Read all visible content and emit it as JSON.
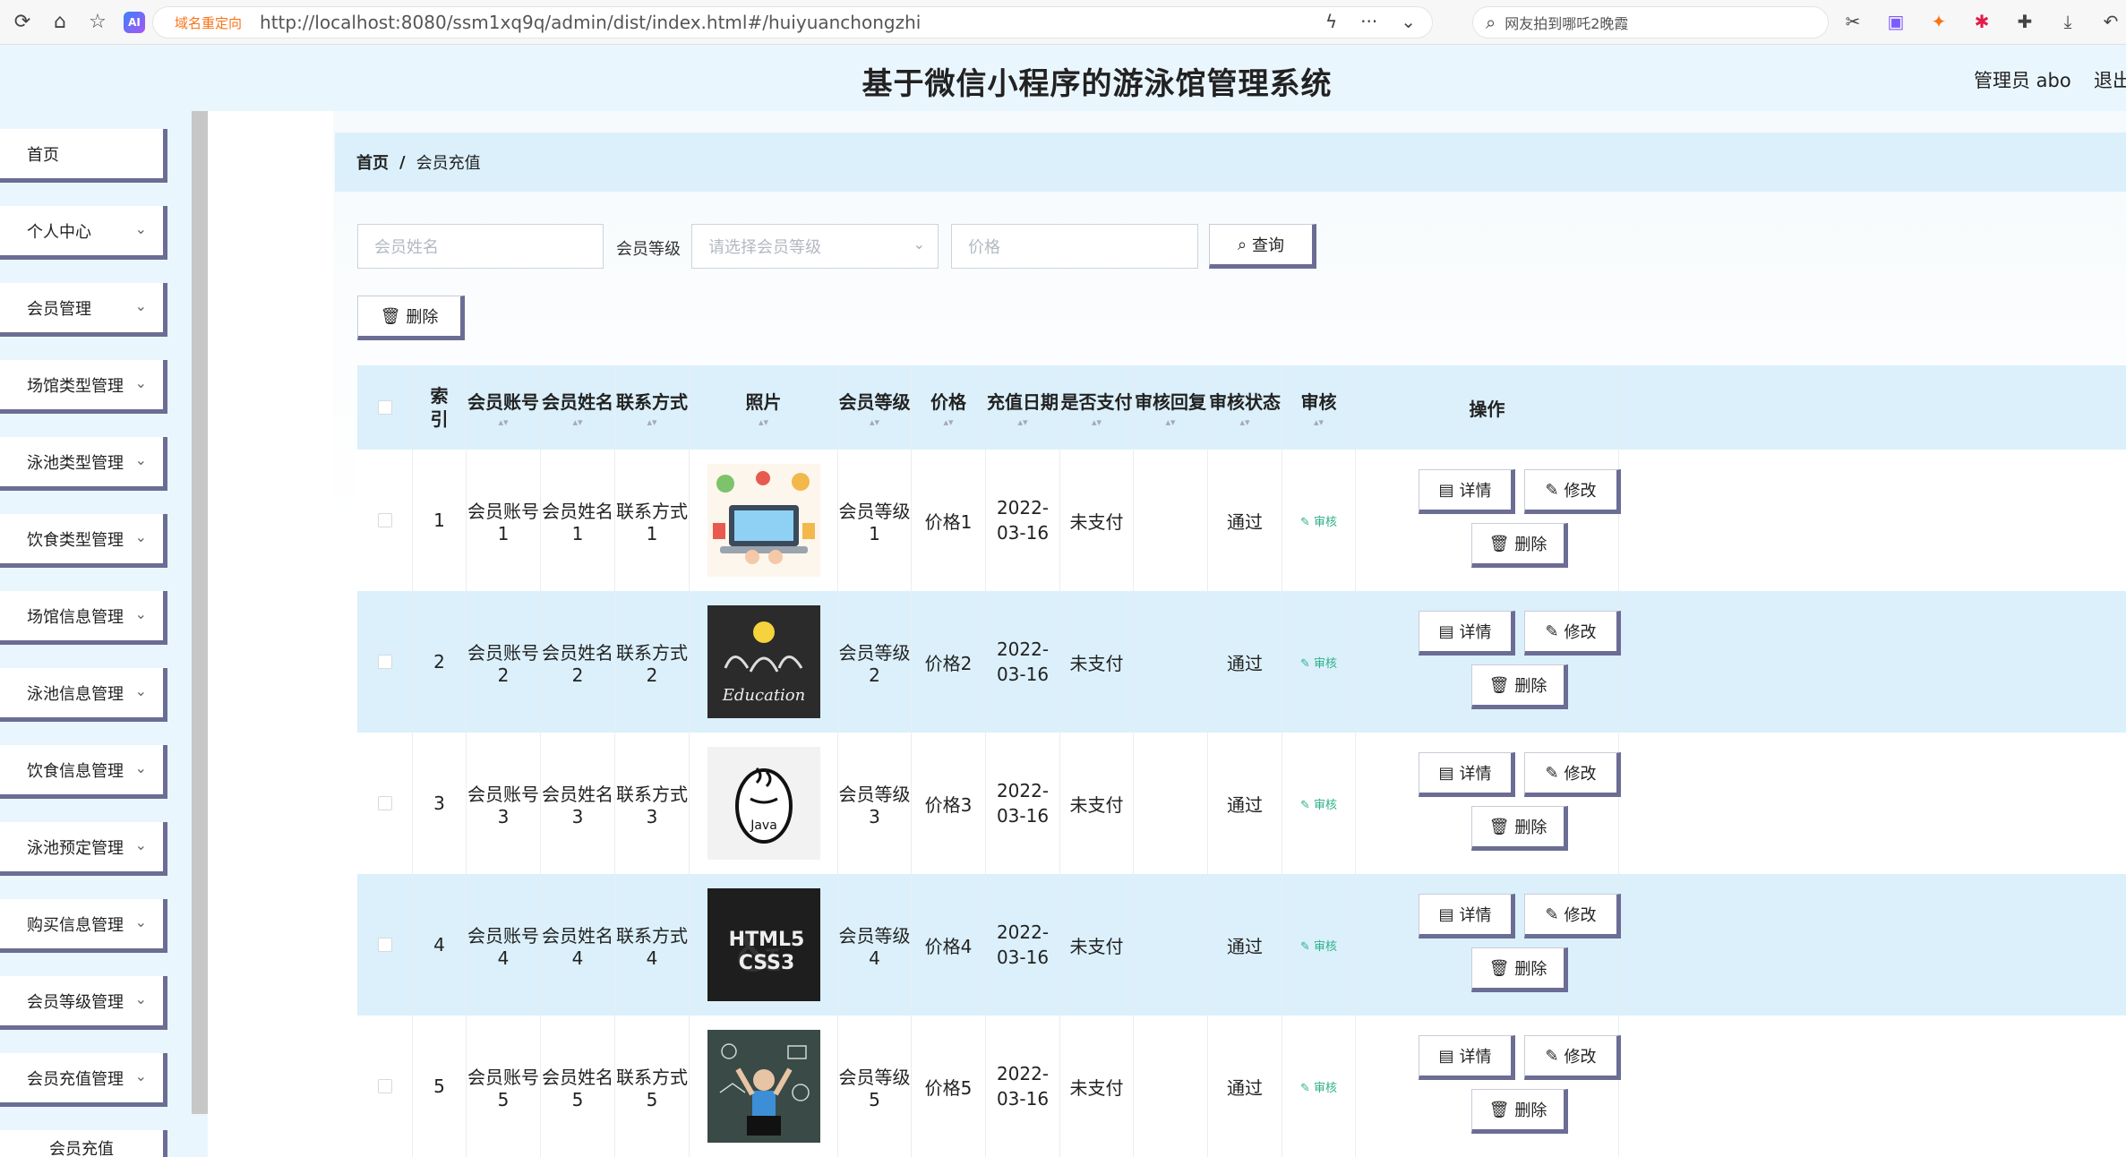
{
  "browser": {
    "redirect_label": "域名重定向",
    "url": "http://localhost:8080/ssm1xq9q/admin/dist/index.html#/huiyuanchongzhi",
    "search_text": "网友拍到哪吒2晚霞"
  },
  "header": {
    "title": "基于微信小程序的游泳馆管理系统",
    "user": "管理员 abo",
    "logout": "退出登录"
  },
  "sidebar": {
    "items": [
      {
        "label": "首页",
        "chevron": false
      },
      {
        "label": "个人中心",
        "chevron": true
      },
      {
        "label": "会员管理",
        "chevron": true
      },
      {
        "label": "场馆类型管理",
        "chevron": true
      },
      {
        "label": "泳池类型管理",
        "chevron": true
      },
      {
        "label": "饮食类型管理",
        "chevron": true
      },
      {
        "label": "场馆信息管理",
        "chevron": true
      },
      {
        "label": "泳池信息管理",
        "chevron": true
      },
      {
        "label": "饮食信息管理",
        "chevron": true
      },
      {
        "label": "泳池预定管理",
        "chevron": true
      },
      {
        "label": "购买信息管理",
        "chevron": true
      },
      {
        "label": "会员等级管理",
        "chevron": true
      },
      {
        "label": "会员充值管理",
        "chevron": true
      }
    ],
    "sub_item": "会员充值"
  },
  "breadcrumb": {
    "home": "首页",
    "separator": "/",
    "current": "会员充值"
  },
  "filters": {
    "name_placeholder": "会员姓名",
    "level_label": "会员等级",
    "level_placeholder": "请选择会员等级",
    "price_placeholder": "价格",
    "search_label": "查询",
    "delete_label": "删除"
  },
  "table": {
    "headers": [
      "索引",
      "会员账号",
      "会员姓名",
      "联系方式",
      "照片",
      "会员等级",
      "价格",
      "充值日期",
      "是否支付",
      "审核回复",
      "审核状态",
      "审核",
      "操作"
    ],
    "rows": [
      {
        "index": "1",
        "account": "会员账号1",
        "name": "会员姓名1",
        "contact": "联系方式1",
        "photo": "laptop-illustration",
        "level": "会员等级1",
        "price": "价格1",
        "date": "2022-03-16",
        "paid": "未支付",
        "reply": "",
        "status": "通过",
        "audit": "审核"
      },
      {
        "index": "2",
        "account": "会员账号2",
        "name": "会员姓名2",
        "contact": "联系方式2",
        "photo": "education-chalkboard",
        "level": "会员等级2",
        "price": "价格2",
        "date": "2022-03-16",
        "paid": "未支付",
        "reply": "",
        "status": "通过",
        "audit": "审核"
      },
      {
        "index": "3",
        "account": "会员账号3",
        "name": "会员姓名3",
        "contact": "联系方式3",
        "photo": "java-logo",
        "level": "会员等级3",
        "price": "价格3",
        "date": "2022-03-16",
        "paid": "未支付",
        "reply": "",
        "status": "通过",
        "audit": "审核"
      },
      {
        "index": "4",
        "account": "会员账号4",
        "name": "会员姓名4",
        "contact": "联系方式4",
        "photo": "html5-css3-book",
        "level": "会员等级4",
        "price": "价格4",
        "date": "2022-03-16",
        "paid": "未支付",
        "reply": "",
        "status": "通过",
        "audit": "审核"
      },
      {
        "index": "5",
        "account": "会员账号5",
        "name": "会员姓名5",
        "contact": "联系方式5",
        "photo": "tech-person-chalkboard",
        "level": "会员等级5",
        "price": "价格5",
        "date": "2022-03-16",
        "paid": "未支付",
        "reply": "",
        "status": "通过",
        "audit": "审核"
      }
    ],
    "actions": {
      "detail": "详情",
      "edit": "修改",
      "delete": "删除"
    }
  },
  "colors": {
    "header_bg": "#eaf6fd",
    "row_blue": "#dbf0fb",
    "button_shadow": "#6b6d94",
    "audit_green": "#2fb08a"
  }
}
